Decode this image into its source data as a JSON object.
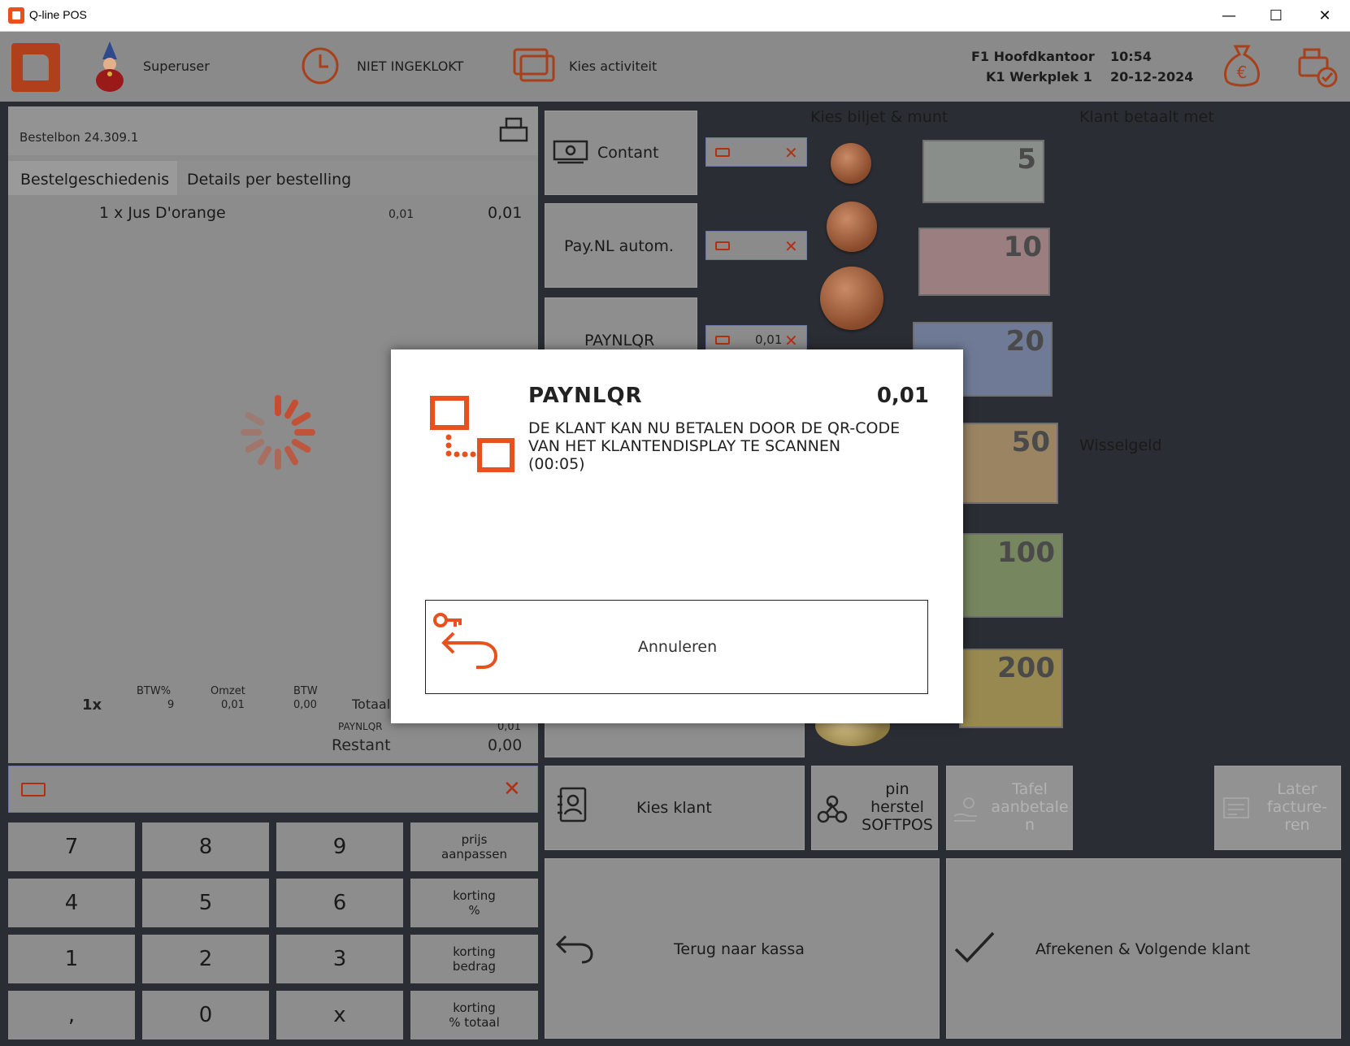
{
  "window": {
    "title": "Q-line POS",
    "minimize": "—",
    "maximize": "☐",
    "close": "✕"
  },
  "header": {
    "user": "Superuser",
    "clock_status": "NIET INGEKLOKT",
    "activity": "Kies activiteit",
    "location_line1": "F1 Hoofdkantoor",
    "location_line2": "K1 Werkplek 1",
    "time": "10:54",
    "date": "20-12-2024"
  },
  "order": {
    "title": "Bestelbon 24.309.1",
    "tabs": [
      "Bestelgeschiedenis",
      "Details per bestelling"
    ],
    "items": [
      {
        "desc": "1 x Jus D'orange",
        "unit": "0,01",
        "total": "0,01"
      }
    ],
    "summary": {
      "count": "1x",
      "btw_pct_label": "BTW%",
      "btw_pct": "9",
      "omzet_label": "Omzet",
      "omzet": "0,01",
      "btw_label": "BTW",
      "btw": "0,00",
      "totaal_label": "Totaal",
      "payment_label": "PAYNLQR",
      "payment_value": "0,01",
      "restant_label": "Restant",
      "restant_value": "0,00"
    }
  },
  "keypad": {
    "keys": [
      "7",
      "8",
      "9",
      "4",
      "5",
      "6",
      "1",
      "2",
      "3",
      ",",
      "0",
      "x"
    ],
    "functions": [
      [
        "prijs",
        "aanpassen"
      ],
      [
        "korting",
        "%"
      ],
      [
        "korting",
        "bedrag"
      ],
      [
        "korting",
        "% totaal"
      ]
    ]
  },
  "payment_methods": [
    {
      "label": "Contant",
      "amount": ""
    },
    {
      "label": "Pay.NL autom.",
      "amount": ""
    },
    {
      "label": "PAYNLQR",
      "amount": "0,01"
    }
  ],
  "cash": {
    "choose_label": "Kies biljet & munt",
    "pays_with_label": "Klant betaalt met",
    "change_label": "Wisselgeld",
    "notes": [
      "5",
      "10",
      "20",
      "50",
      "100",
      "200"
    ]
  },
  "actions": {
    "kies_klant": "Kies klant",
    "pin_herstel": [
      "pin",
      "herstel",
      "SOFTPOS"
    ],
    "tafel": [
      "Tafel",
      "aanbetale",
      "n"
    ],
    "later": [
      "Later",
      "facture-",
      "ren"
    ],
    "terug": "Terug naar kassa",
    "afrekenen": "Afrekenen & Volgende klant"
  },
  "modal": {
    "title": "PAYNLQR",
    "amount": "0,01",
    "message_line1": "DE KLANT KAN NU BETALEN DOOR DE QR-CODE",
    "message_line2": "VAN HET KLANTENDISPLAY TE SCANNEN",
    "message_line3": "(00:05)",
    "cancel_label": "Annuleren"
  },
  "colors": {
    "accent": "#e8501e",
    "overlay_gray": "#8c8c8c",
    "background": "#2a2d33"
  }
}
